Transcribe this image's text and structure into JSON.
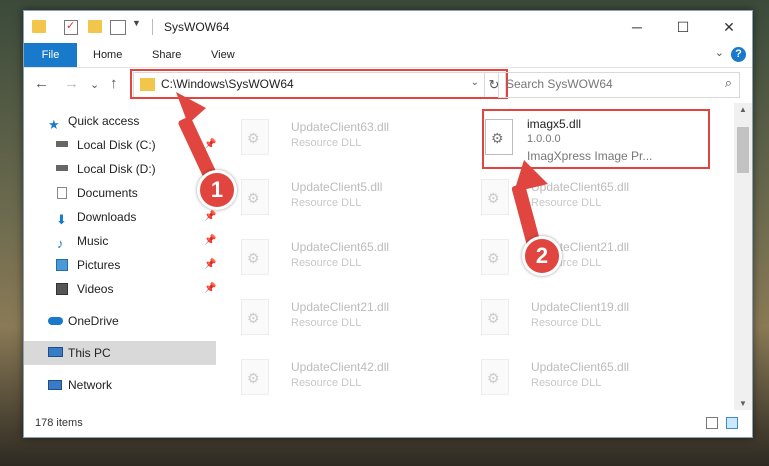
{
  "window": {
    "title": "SysWOW64",
    "minimize_glyph": "─",
    "maximize_glyph": "☐",
    "close_glyph": "✕"
  },
  "ribbon": {
    "tabs": [
      "File",
      "Home",
      "Share",
      "View"
    ],
    "help_glyph": "?",
    "expand_glyph": "⌄",
    "accent": "#1979ca"
  },
  "nav": {
    "back_glyph": "←",
    "forward_glyph": "→",
    "recent_glyph": "⌄",
    "up_glyph": "↑",
    "address": "C:\\Windows\\SysWOW64",
    "address_dropdown_glyph": "⌄",
    "refresh_glyph": "↻",
    "search_placeholder": "Search SysWOW64",
    "search_glyph": "⌕"
  },
  "sidebar": {
    "items": [
      {
        "label": "Quick access",
        "icon": "star-icon",
        "pinned": false
      },
      {
        "label": "Local Disk (C:)",
        "icon": "drive-icon",
        "pinned": true
      },
      {
        "label": "Local Disk (D:)",
        "icon": "drive-icon",
        "pinned": false
      },
      {
        "label": "Documents",
        "icon": "documents-icon",
        "pinned": true
      },
      {
        "label": "Downloads",
        "icon": "download-icon",
        "pinned": true
      },
      {
        "label": "Music",
        "icon": "music-icon",
        "pinned": true
      },
      {
        "label": "Pictures",
        "icon": "pictures-icon",
        "pinned": true
      },
      {
        "label": "Videos",
        "icon": "videos-icon",
        "pinned": true
      },
      {
        "label": "OneDrive",
        "icon": "cloud-icon",
        "pinned": false
      },
      {
        "label": "This PC",
        "icon": "computer-icon",
        "pinned": false,
        "selected": true
      },
      {
        "label": "Network",
        "icon": "network-icon",
        "pinned": false
      }
    ],
    "pin_glyph": "📌"
  },
  "files": [
    {
      "name": "UpdateClient63.dll",
      "type": "Resource DLL"
    },
    {
      "name": "imagx5.dll",
      "type": "1.0.0.0",
      "company": "ImagXpress Image Pr...",
      "active": true
    },
    {
      "name": "UpdateClient5.dll",
      "type": "Resource DLL"
    },
    {
      "name": "UpdateClient65.dll",
      "type": "Resource DLL"
    },
    {
      "name": "UpdateClient65.dll",
      "type": "Resource DLL"
    },
    {
      "name": "UpdateClient21.dll",
      "type": "Resource DLL"
    },
    {
      "name": "UpdateClient21.dll",
      "type": "Resource DLL"
    },
    {
      "name": "UpdateClient19.dll",
      "type": "Resource DLL"
    },
    {
      "name": "UpdateClient42.dll",
      "type": "Resource DLL"
    },
    {
      "name": "UpdateClient65.dll",
      "type": "Resource DLL"
    }
  ],
  "status": {
    "item_count": "178 items"
  },
  "annotations": {
    "step1": "1",
    "step2": "2",
    "color": "#e0453f"
  }
}
